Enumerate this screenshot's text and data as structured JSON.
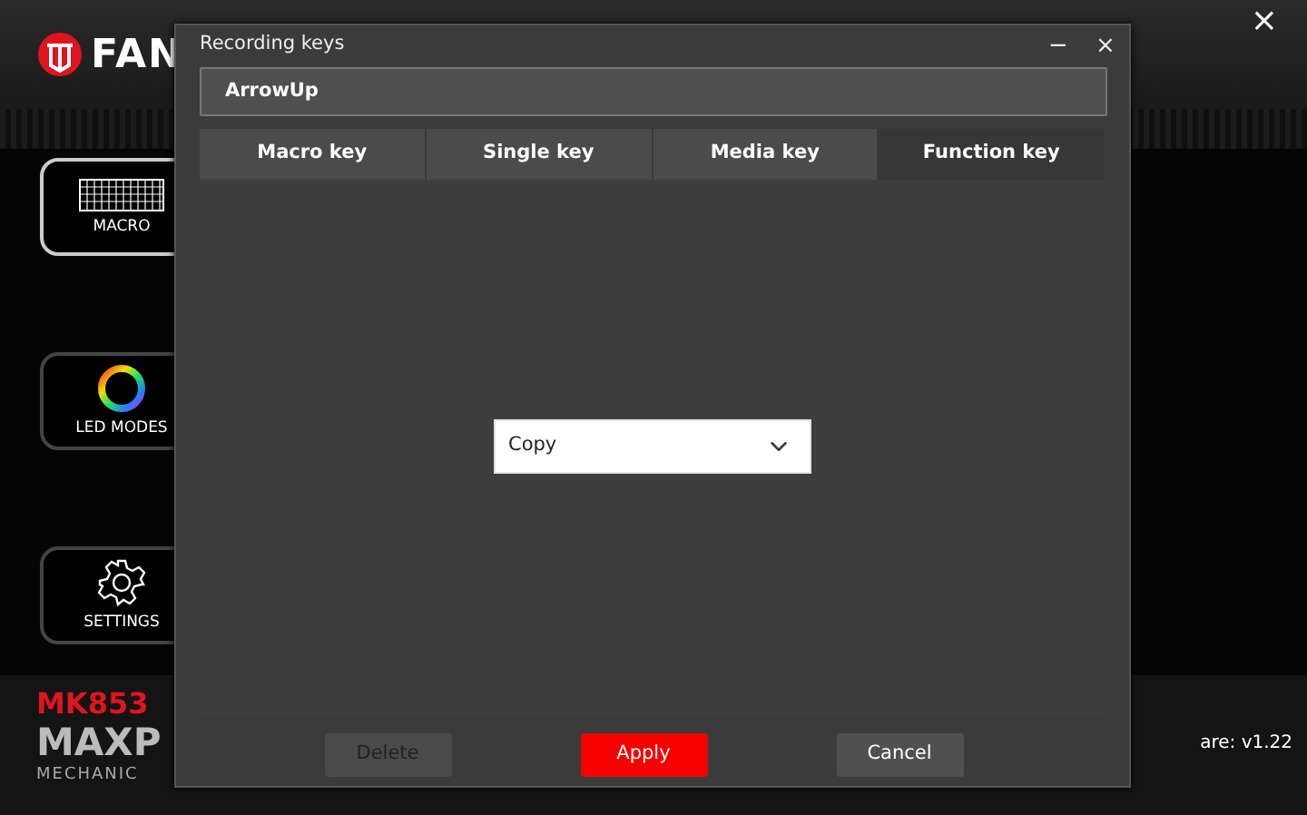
{
  "app": {
    "logo_text": "FAN",
    "close": "×",
    "sidebar": [
      {
        "kind": "keyboard",
        "label": "MACRO",
        "selected": true
      },
      {
        "kind": "ring",
        "label": "LED MODES",
        "selected": false
      },
      {
        "kind": "gear",
        "label": "SETTINGS",
        "selected": false
      }
    ],
    "model": "MK853",
    "brand_line": "MAXP",
    "sub_line": "MECHANIC",
    "firmware": "are: v1.22"
  },
  "dialog": {
    "title": "Recording keys",
    "minimize": "−",
    "close": "×",
    "key_field": {
      "value": "ArrowUp"
    },
    "tabs": [
      {
        "label": "Macro key",
        "selected": false
      },
      {
        "label": "Single key",
        "selected": false
      },
      {
        "label": "Media key",
        "selected": false
      },
      {
        "label": "Function key",
        "selected": true
      }
    ],
    "function_select": {
      "value": "Copy"
    },
    "buttons": [
      {
        "kind": "secondary",
        "label": "Delete",
        "disabled": true
      },
      {
        "kind": "primary",
        "label": "Apply",
        "disabled": false
      },
      {
        "kind": "secondary",
        "label": "Cancel",
        "disabled": false
      }
    ]
  }
}
